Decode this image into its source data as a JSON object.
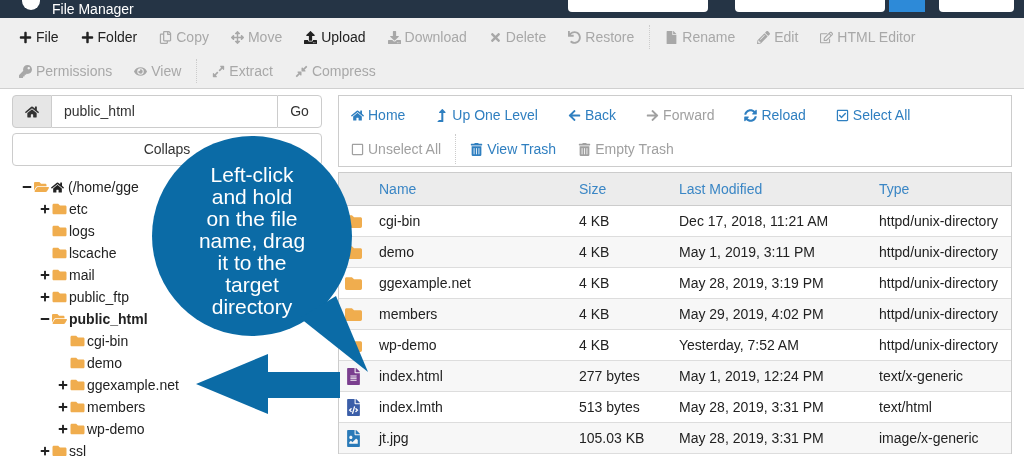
{
  "header": {
    "title": "File Manager"
  },
  "toolbar": [
    {
      "label": "File",
      "disabled": false
    },
    {
      "label": "Folder",
      "disabled": false
    },
    {
      "label": "Copy",
      "disabled": true
    },
    {
      "label": "Move",
      "disabled": true
    },
    {
      "label": "Upload",
      "disabled": false
    },
    {
      "label": "Download",
      "disabled": true
    },
    {
      "label": "Delete",
      "disabled": true
    },
    {
      "label": "Restore",
      "disabled": true
    },
    {
      "label": "Rename",
      "disabled": true
    },
    {
      "label": "Edit",
      "disabled": true
    },
    {
      "label": "HTML Editor",
      "disabled": true
    },
    {
      "label": "Permissions",
      "disabled": true
    },
    {
      "label": "View",
      "disabled": true
    },
    {
      "label": "Extract",
      "disabled": true
    },
    {
      "label": "Compress",
      "disabled": true
    }
  ],
  "path_bar": {
    "value": "public_html",
    "go": "Go"
  },
  "collapse_button": "Collaps",
  "tree": [
    {
      "label": "(/home/gge",
      "expanded": true,
      "has_children": true,
      "selected": false,
      "children": [
        {
          "label": "etc",
          "expanded": false,
          "has_children": true,
          "selected": false
        },
        {
          "label": "logs",
          "expanded": false,
          "has_children": false,
          "selected": false
        },
        {
          "label": "lscache",
          "expanded": false,
          "has_children": false,
          "selected": false
        },
        {
          "label": "mail",
          "expanded": false,
          "has_children": true,
          "selected": false
        },
        {
          "label": "public_ftp",
          "expanded": false,
          "has_children": true,
          "selected": false
        },
        {
          "label": "public_html",
          "expanded": true,
          "has_children": true,
          "selected": true,
          "children": [
            {
              "label": "cgi-bin",
              "expanded": false,
              "has_children": false,
              "selected": false
            },
            {
              "label": "demo",
              "expanded": false,
              "has_children": false,
              "selected": false
            },
            {
              "label": "ggexample.net",
              "expanded": false,
              "has_children": true,
              "selected": false
            },
            {
              "label": "members",
              "expanded": false,
              "has_children": true,
              "selected": false
            },
            {
              "label": "wp-demo",
              "expanded": false,
              "has_children": true,
              "selected": false
            }
          ]
        },
        {
          "label": "ssl",
          "expanded": false,
          "has_children": true,
          "selected": false
        }
      ]
    }
  ],
  "nav": [
    {
      "label": "Home",
      "disabled": false
    },
    {
      "label": "Up One Level",
      "disabled": false
    },
    {
      "label": "Back",
      "disabled": false
    },
    {
      "label": "Forward",
      "disabled": true
    },
    {
      "label": "Reload",
      "disabled": false
    },
    {
      "label": "Select All",
      "disabled": false
    },
    {
      "label": "Unselect All",
      "disabled": true
    },
    {
      "label": "View Trash",
      "disabled": false
    },
    {
      "label": "Empty Trash",
      "disabled": true
    }
  ],
  "table": {
    "columns": [
      "Name",
      "Size",
      "Last Modified",
      "Type"
    ],
    "rows": [
      {
        "kind": "folder",
        "name": "cgi-bin",
        "size": "4 KB",
        "modified": "Dec 17, 2018, 11:21 AM",
        "type": "httpd/unix-directory"
      },
      {
        "kind": "folder",
        "name": "demo",
        "size": "4 KB",
        "modified": "May 1, 2019, 3:11 PM",
        "type": "httpd/unix-directory"
      },
      {
        "kind": "folder",
        "name": "ggexample.net",
        "size": "4 KB",
        "modified": "May 28, 2019, 3:19 PM",
        "type": "httpd/unix-directory"
      },
      {
        "kind": "folder",
        "name": "members",
        "size": "4 KB",
        "modified": "May 29, 2019, 4:02 PM",
        "type": "httpd/unix-directory"
      },
      {
        "kind": "folder",
        "name": "wp-demo",
        "size": "4 KB",
        "modified": "Yesterday, 7:52 AM",
        "type": "httpd/unix-directory"
      },
      {
        "kind": "document",
        "name": "index.html",
        "size": "277 bytes",
        "modified": "May 1, 2019, 12:24 PM",
        "type": "text/x-generic"
      },
      {
        "kind": "code",
        "name": "index.lmth",
        "size": "513 bytes",
        "modified": "May 28, 2019, 3:31 PM",
        "type": "text/html"
      },
      {
        "kind": "image",
        "name": "jt.jpg",
        "size": "105.03 KB",
        "modified": "May 28, 2019, 3:31 PM",
        "type": "image/x-generic"
      }
    ]
  },
  "callout": {
    "text": "Left-click and hold on the file name, drag it to the target directory"
  }
}
